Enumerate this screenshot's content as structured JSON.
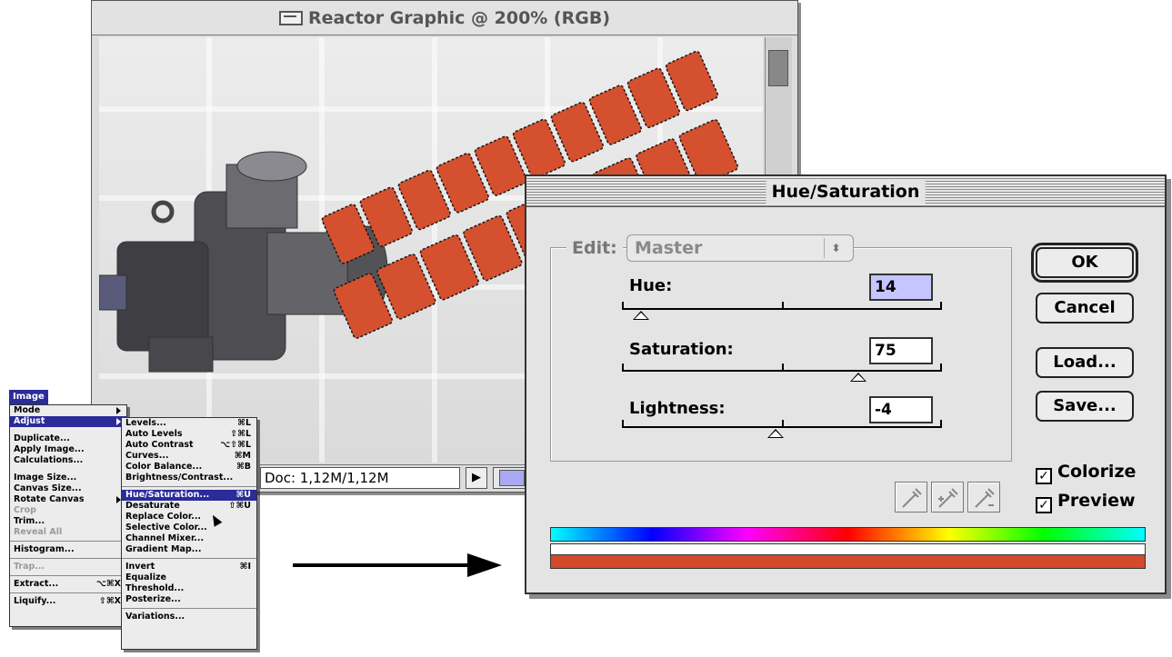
{
  "document_window": {
    "title": "Reactor Graphic @ 200% (RGB)",
    "status_text": "Doc: 1,12M/1,12M",
    "status_arrow": "▶"
  },
  "image_menu": {
    "title": "Image",
    "items": [
      {
        "label": "Mode",
        "submenu": true
      },
      {
        "label": "Adjust",
        "submenu": true,
        "selected": true
      },
      {
        "label": "Duplicate...",
        "gap": true
      },
      {
        "label": "Apply Image..."
      },
      {
        "label": "Calculations..."
      },
      {
        "label": "Image Size...",
        "gap": true
      },
      {
        "label": "Canvas Size..."
      },
      {
        "label": "Rotate Canvas",
        "submenu": true
      },
      {
        "label": "Crop",
        "disabled": true
      },
      {
        "label": "Trim..."
      },
      {
        "label": "Reveal All",
        "disabled": true
      },
      {
        "label": "Histogram...",
        "separator_before": true
      },
      {
        "label": "Trap...",
        "disabled": true,
        "separator_before": true
      },
      {
        "label": "Extract...",
        "shortcut": "⌥⌘X",
        "separator_before": true
      },
      {
        "label": "Liquify...",
        "shortcut": "⇧⌘X",
        "separator_before": true
      }
    ]
  },
  "adjust_menu": {
    "items": [
      {
        "label": "Levels...",
        "shortcut": "⌘L"
      },
      {
        "label": "Auto Levels",
        "shortcut": "⇧⌘L"
      },
      {
        "label": "Auto Contrast",
        "shortcut": "⌥⇧⌘L"
      },
      {
        "label": "Curves...",
        "shortcut": "⌘M"
      },
      {
        "label": "Color Balance...",
        "shortcut": "⌘B"
      },
      {
        "label": "Brightness/Contrast..."
      },
      {
        "label": "Hue/Saturation...",
        "shortcut": "⌘U",
        "selected": true,
        "separator_before": true
      },
      {
        "label": "Desaturate",
        "shortcut": "⇧⌘U"
      },
      {
        "label": "Replace Color..."
      },
      {
        "label": "Selective Color..."
      },
      {
        "label": "Channel Mixer..."
      },
      {
        "label": "Gradient Map..."
      },
      {
        "label": "Invert",
        "shortcut": "⌘I",
        "separator_before": true
      },
      {
        "label": "Equalize"
      },
      {
        "label": "Threshold..."
      },
      {
        "label": "Posterize..."
      },
      {
        "label": "Variations...",
        "separator_before": true
      }
    ]
  },
  "dialog": {
    "title": "Hue/Saturation",
    "edit_label": "Edit:",
    "edit_value": "Master",
    "edit_dropdown_icon": "⬍",
    "hue": {
      "label": "Hue:",
      "value": "14",
      "position": 0.06
    },
    "saturation": {
      "label": "Saturation:",
      "value": "75",
      "position": 0.74
    },
    "lightness": {
      "label": "Lightness:",
      "value": "-4",
      "position": 0.48
    },
    "buttons": {
      "ok": "OK",
      "cancel": "Cancel",
      "load": "Load...",
      "save": "Save..."
    },
    "colorize": {
      "label": "Colorize",
      "checked": true
    },
    "preview": {
      "label": "Preview",
      "checked": true
    },
    "check_mark": "✓",
    "result_color": "#d24a2c"
  }
}
